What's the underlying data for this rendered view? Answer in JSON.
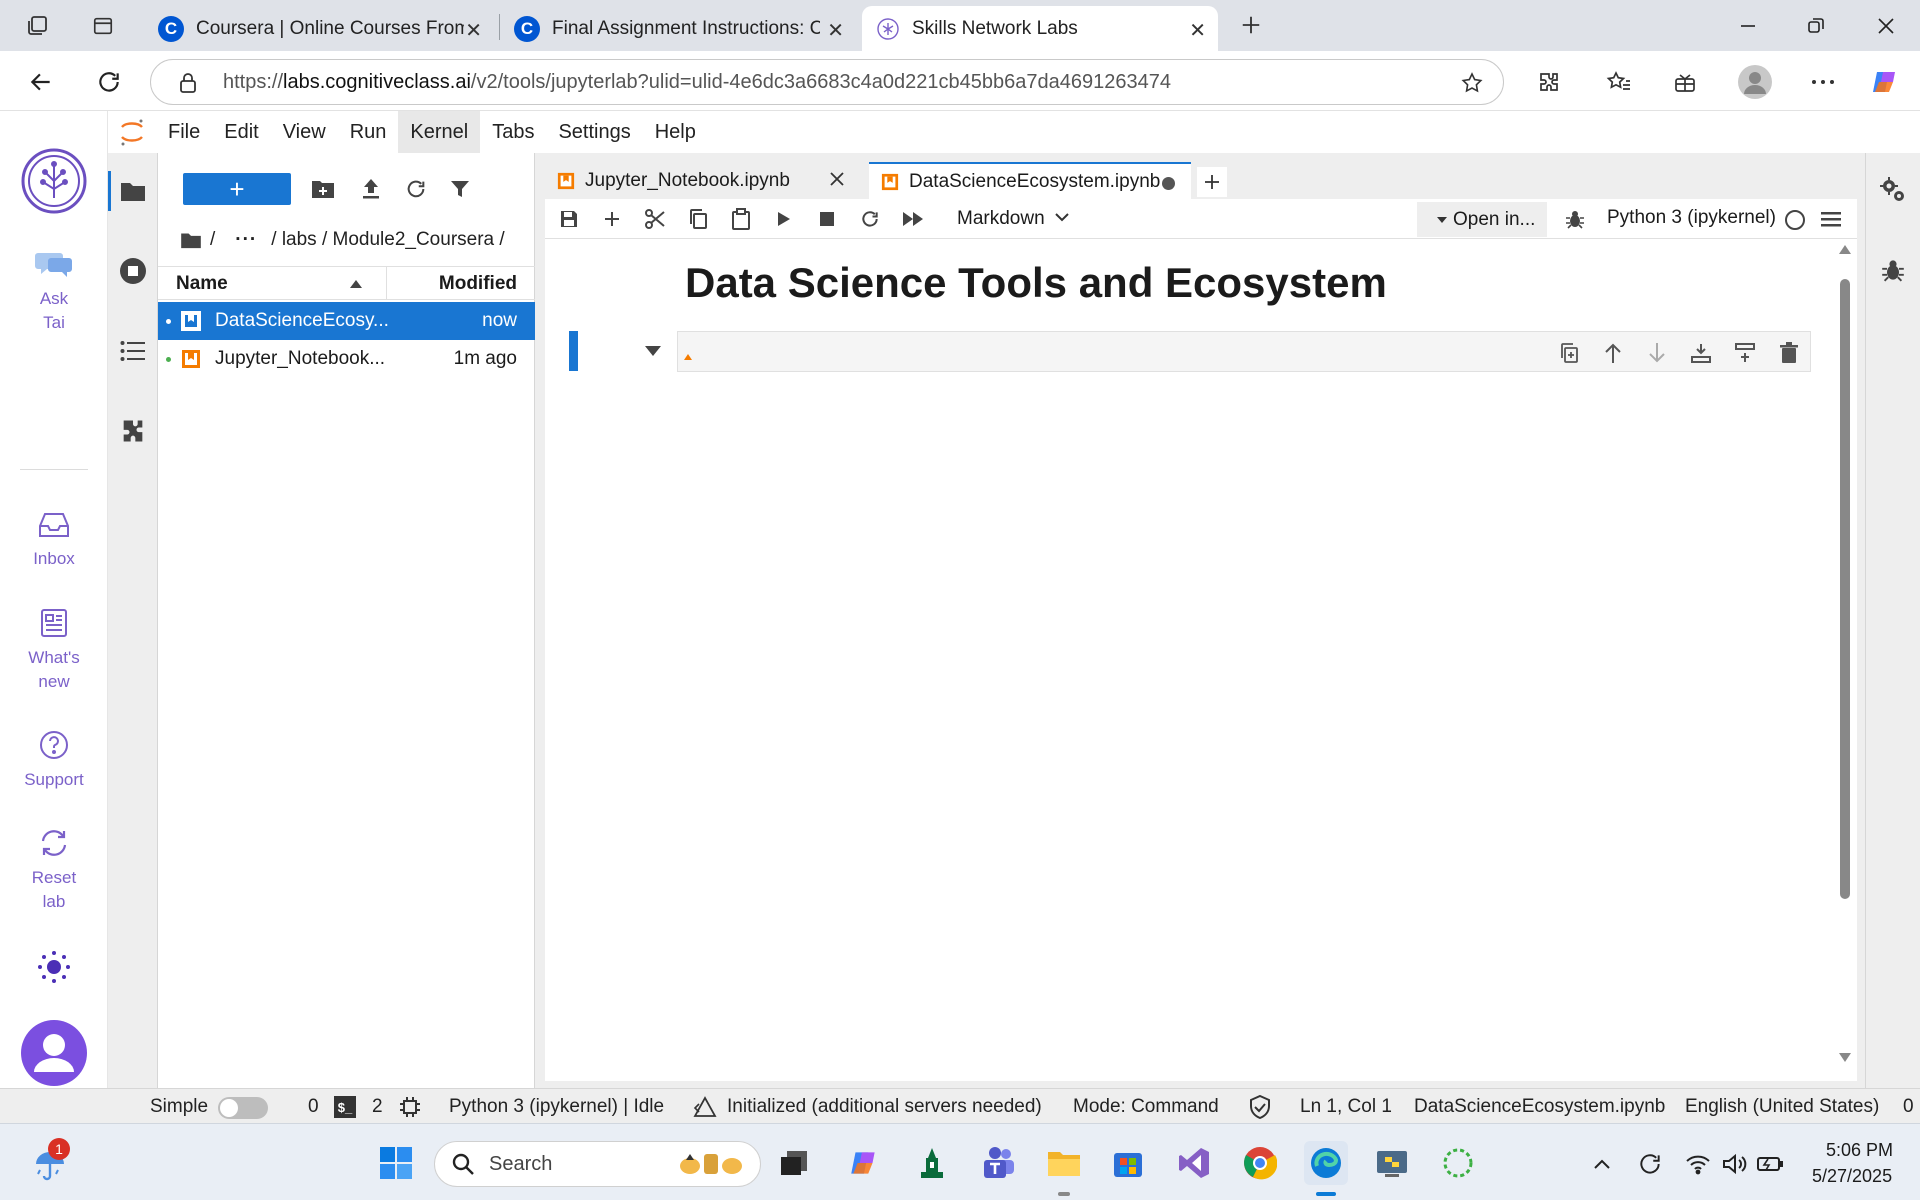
{
  "browser": {
    "tabs": [
      {
        "title": "Coursera | Online Courses From To"
      },
      {
        "title": "Final Assignment Instructions: Cre"
      },
      {
        "title": "Skills Network Labs"
      }
    ],
    "url_prefix": "https://",
    "url_domain": "labs.cognitiveclass.ai",
    "url_path": "/v2/tools/jupyterlab?ulid=ulid-4e6dc3a6683c4a0d221cb45bb6a7da4691263474",
    "coursera_letter": "C"
  },
  "skills_sidebar": {
    "items": [
      {
        "label": "Ask Tai"
      },
      {
        "label": "Inbox"
      },
      {
        "label": "What's new"
      },
      {
        "label": "Support"
      },
      {
        "label": "Reset lab"
      }
    ]
  },
  "menu": [
    "File",
    "Edit",
    "View",
    "Run",
    "Kernel",
    "Tabs",
    "Settings",
    "Help"
  ],
  "file_browser": {
    "new_label": "+",
    "crumbs": {
      "root": "/",
      "ellipsis": "···",
      "path": "/ labs / Module2_Coursera /"
    },
    "columns": {
      "name": "Name",
      "modified": "Modified"
    },
    "files": [
      {
        "name": "DataScienceEcosy...",
        "modified": "now"
      },
      {
        "name": "Jupyter_Notebook...",
        "modified": "1m ago"
      }
    ]
  },
  "notebook_tabs": [
    {
      "label": "Jupyter_Notebook.ipynb"
    },
    {
      "label": "DataScienceEcosystem.ipynb"
    }
  ],
  "toolbar": {
    "cell_type": "Markdown",
    "open_in": "Open in...",
    "kernel": "Python 3 (ipykernel)"
  },
  "notebook": {
    "heading": "Data Science Tools and Ecosystem",
    "cell_text": ""
  },
  "status": {
    "mode_simple": "Simple",
    "terminals": "0",
    "kernels": "2",
    "kernel_status": "Python 3 (ipykernel) | Idle",
    "lsp": "Initialized (additional servers needed)",
    "mode": "Mode: Command",
    "position": "Ln 1, Col 1",
    "filename": "DataScienceEcosystem.ipynb",
    "language": "English (United States)",
    "notifications": "0"
  },
  "taskbar": {
    "search_label": "Search",
    "weather_badge": "1",
    "time": "5:06 PM",
    "date": "5/27/2025"
  },
  "colors": {
    "jupyter_blue": "#1976d2",
    "skills_purple": "#7b61c9",
    "notebook_orange": "#f57c00"
  }
}
